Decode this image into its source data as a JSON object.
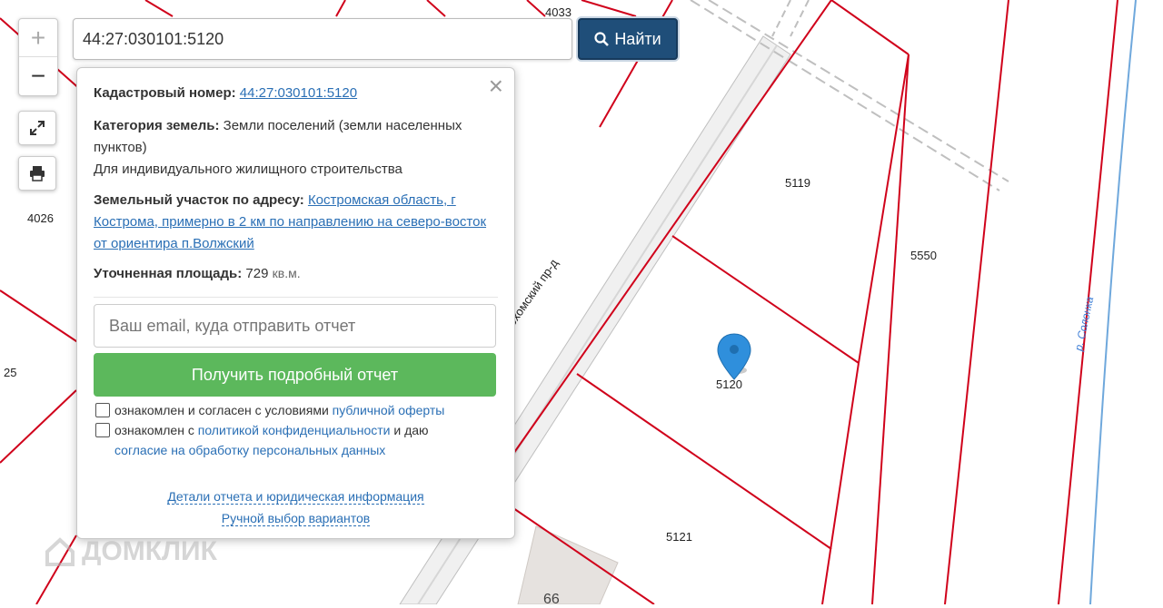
{
  "search": {
    "value": "44:27:030101:5120",
    "button_label": "Найти"
  },
  "zoom": {
    "in_label": "+",
    "out_label": "−"
  },
  "controls": {
    "fullscreen_icon": "expand-icon",
    "print_icon": "printer-icon"
  },
  "popup": {
    "cadastral_label": "Кадастровый номер:",
    "cadastral_value": "44:27:030101:5120",
    "category_label": "Категория земель:",
    "category_value": "Земли поселений (земли населенных пунктов)",
    "usage_value": "Для индивидуального жилищного строительства",
    "address_label": "Земельный участок по адресу:",
    "address_value": "Костромская область, г Кострома, примерно в 2 км по направлению на северо-восток от ориентира п.Волжский",
    "area_label": "Уточненная площадь:",
    "area_value": "729",
    "area_unit": "кв.м.",
    "email_placeholder": "Ваш email, куда отправить отчет",
    "report_button": "Получить подробный отчет",
    "consent1_text": "ознакомлен и согласен с условиями",
    "consent1_link": "публичной оферты",
    "consent2_text_a": "ознакомлен с",
    "consent2_link_a": "политикой конфиденциальности",
    "consent2_text_b": "и даю",
    "consent2_link_b": "согласие на обработку персональных данных",
    "details_link": "Детали отчета и юридическая информация",
    "manual_link": "Ручной выбор вариантов"
  },
  "map": {
    "plot_labels": [
      "4033",
      "4026",
      "5119",
      "5550",
      "5120",
      "5121",
      "25"
    ],
    "street_label": "...рохомский пр-д",
    "river_label": "р. Солонка",
    "building_label": "66",
    "boundary_color": "#d0021b",
    "river_color": "#6fa8dc",
    "marker_color": "#2f8fdc"
  },
  "watermark": "ДОМКЛИК"
}
